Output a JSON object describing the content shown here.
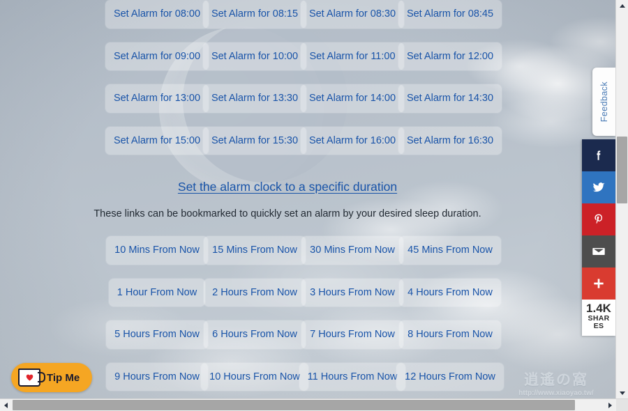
{
  "page": {
    "alarm_buttons": [
      "Set Alarm for 08:00",
      "Set Alarm for 08:15",
      "Set Alarm for 08:30",
      "Set Alarm for 08:45",
      "Set Alarm for 09:00",
      "Set Alarm for 10:00",
      "Set Alarm for 11:00",
      "Set Alarm for 12:00",
      "Set Alarm for 13:00",
      "Set Alarm for 13:30",
      "Set Alarm for 14:00",
      "Set Alarm for 14:30",
      "Set Alarm for 15:00",
      "Set Alarm for 15:30",
      "Set Alarm for 16:00",
      "Set Alarm for 16:30"
    ],
    "section_link": "Set the alarm clock to a specific duration",
    "section_description": "These links can be bookmarked to quickly set an alarm by your desired sleep duration.",
    "duration_buttons": [
      "10 Mins From Now",
      "15 Mins From Now",
      "30 Mins From Now",
      "45 Mins From Now",
      "1 Hour From Now",
      "2 Hours From Now",
      "3 Hours From Now",
      "4 Hours From Now",
      "5 Hours From Now",
      "6 Hours From Now",
      "7 Hours From Now",
      "8 Hours From Now",
      "9 Hours From Now",
      "10 Hours From Now",
      "11 Hours From Now",
      "12 Hours From Now"
    ]
  },
  "feedback": {
    "label": "Feedback"
  },
  "share": {
    "items": [
      {
        "name": "facebook",
        "icon": "facebook-icon",
        "color": "#1b2a4e"
      },
      {
        "name": "twitter",
        "icon": "twitter-icon",
        "color": "#2f74c0"
      },
      {
        "name": "pinterest",
        "icon": "pinterest-icon",
        "color": "#cc2127"
      },
      {
        "name": "email",
        "icon": "envelope-icon",
        "color": "#4d4d4d"
      },
      {
        "name": "more",
        "icon": "plus-icon",
        "color": "#d93b30"
      }
    ],
    "count": "1.4K",
    "count_label": "SHARES"
  },
  "tip": {
    "label": "Tip Me",
    "icon": "coffee-mug-heart-icon",
    "color": "#f5a623"
  },
  "watermark": {
    "mark": "逍遙の窩",
    "url": "http://www.xiaoyao.tw/"
  },
  "colors": {
    "link": "#1853a8",
    "text": "#222a33",
    "tile_bg": "rgba(255,255,255,0.30)"
  }
}
